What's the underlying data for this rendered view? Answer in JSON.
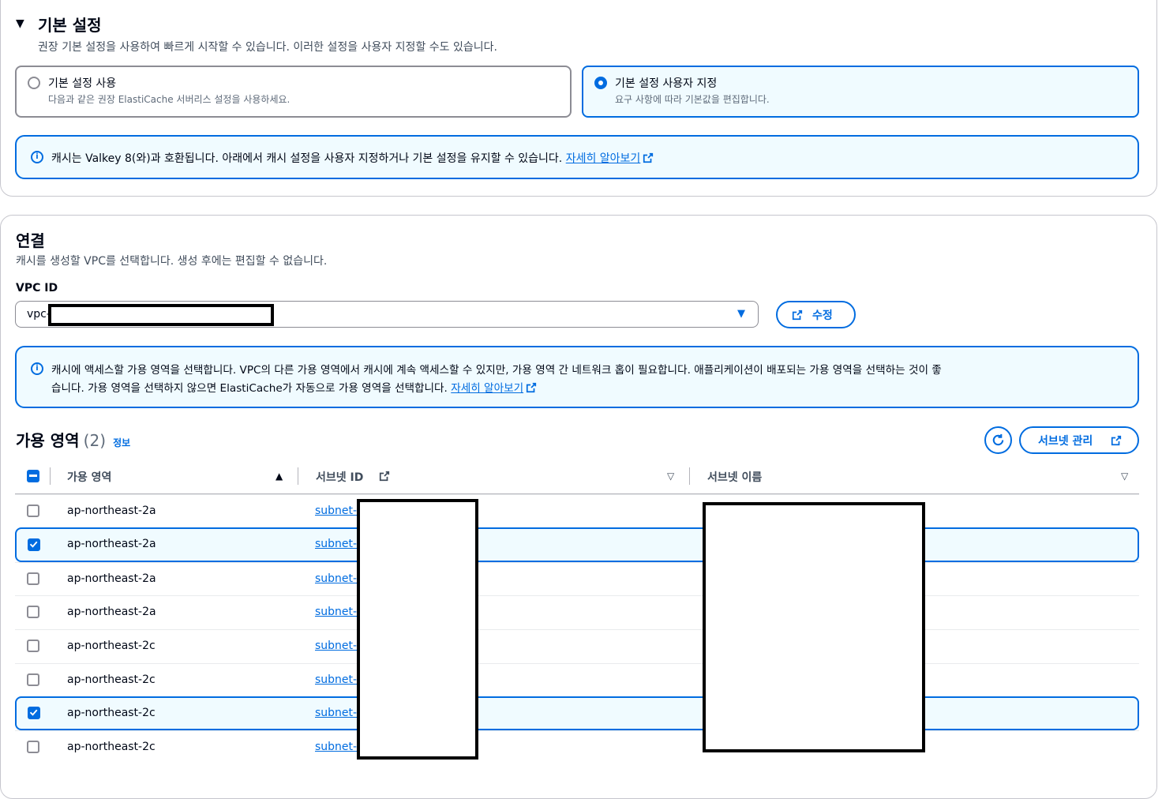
{
  "defaults": {
    "title": "기본 설정",
    "description": "권장 기본 설정을 사용하여 빠르게 시작할 수 있습니다. 이러한 설정을 사용자 지정할 수도 있습니다.",
    "options": [
      {
        "label": "기본 설정 사용",
        "desc": "다음과 같은 권장 ElastiCache 서버리스 설정을 사용하세요.",
        "selected": false
      },
      {
        "label": "기본 설정 사용자 지정",
        "desc": "요구 사항에 따라 기본값을 편집합니다.",
        "selected": true
      }
    ],
    "alert_text": "캐시는 Valkey 8(와)과 호환됩니다. 아래에서 캐시 설정을 사용자 지정하거나 기본 설정을 유지할 수 있습니다.",
    "alert_link": "자세히 알아보기"
  },
  "connection": {
    "title": "연결",
    "description": "캐시를 생성할 VPC를 선택합니다. 생성 후에는 편집할 수 없습니다.",
    "vpc_label": "VPC ID",
    "vpc_value": "vpc-",
    "edit_button": "수정",
    "alert_line1": "캐시에 액세스할 가용 영역을 선택합니다. VPC의 다른 가용 영역에서 캐시에 계속 액세스할 수 있지만, 가용 영역 간 네트워크 홉이 필요합니다. 애플리케이션이 배포되는 가용 영역을 선택하는 것이 좋",
    "alert_line2": "습니다. 가용 영역을 선택하지 않으면 ElastiCache가 자동으로 가용 영역을 선택합니다.",
    "alert_link": "자세히 알아보기"
  },
  "az_table": {
    "title": "가용 영역",
    "count": "(2)",
    "info_link": "정보",
    "manage_subnets_button": "서브넷 관리",
    "columns": [
      "가용 영역",
      "서브넷 ID",
      "서브넷 이름"
    ],
    "rows": [
      {
        "az": "ap-northeast-2a",
        "subnet": "subnet-",
        "checked": false
      },
      {
        "az": "ap-northeast-2a",
        "subnet": "subnet-",
        "checked": true
      },
      {
        "az": "ap-northeast-2a",
        "subnet": "subnet-",
        "checked": false
      },
      {
        "az": "ap-northeast-2a",
        "subnet": "subnet-",
        "checked": false
      },
      {
        "az": "ap-northeast-2c",
        "subnet": "subnet-",
        "checked": false
      },
      {
        "az": "ap-northeast-2c",
        "subnet": "subnet-",
        "checked": false
      },
      {
        "az": "ap-northeast-2c",
        "subnet": "subnet-",
        "checked": true
      },
      {
        "az": "ap-northeast-2c",
        "subnet": "subnet-",
        "checked": false
      }
    ]
  },
  "colors": {
    "accent": "#006ce0",
    "selected_bg": "#f0fbff",
    "border": "#8c8c94"
  }
}
